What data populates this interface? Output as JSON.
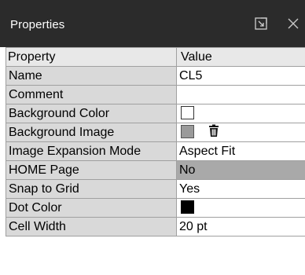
{
  "window": {
    "title": "Properties",
    "popout_icon": "popout-icon",
    "close_icon": "close-icon"
  },
  "grid": {
    "columns": {
      "property": "Property",
      "value": "Value"
    },
    "rows": [
      {
        "name": "Name",
        "value": "CL5"
      },
      {
        "name": "Comment",
        "value": ""
      },
      {
        "name": "Background Color",
        "value": "",
        "swatch": "#ffffff"
      },
      {
        "name": "Background Image",
        "value": "",
        "swatch": "#9a9a9a",
        "icon": "trash-icon"
      },
      {
        "name": "Image Expansion Mode",
        "value": "Aspect Fit"
      },
      {
        "name": "HOME Page",
        "value": "No",
        "selected": true
      },
      {
        "name": "Snap to Grid",
        "value": "Yes"
      },
      {
        "name": "Dot Color",
        "value": "",
        "swatch": "#000000"
      },
      {
        "name": "Cell Width",
        "value": "20 pt"
      }
    ]
  },
  "colors": {
    "titlebar_bg": "#2b2b2b",
    "name_col_bg": "#d9d9d9",
    "selected_value_bg": "#a9a9a9",
    "grid_line": "#a0a0a0"
  }
}
